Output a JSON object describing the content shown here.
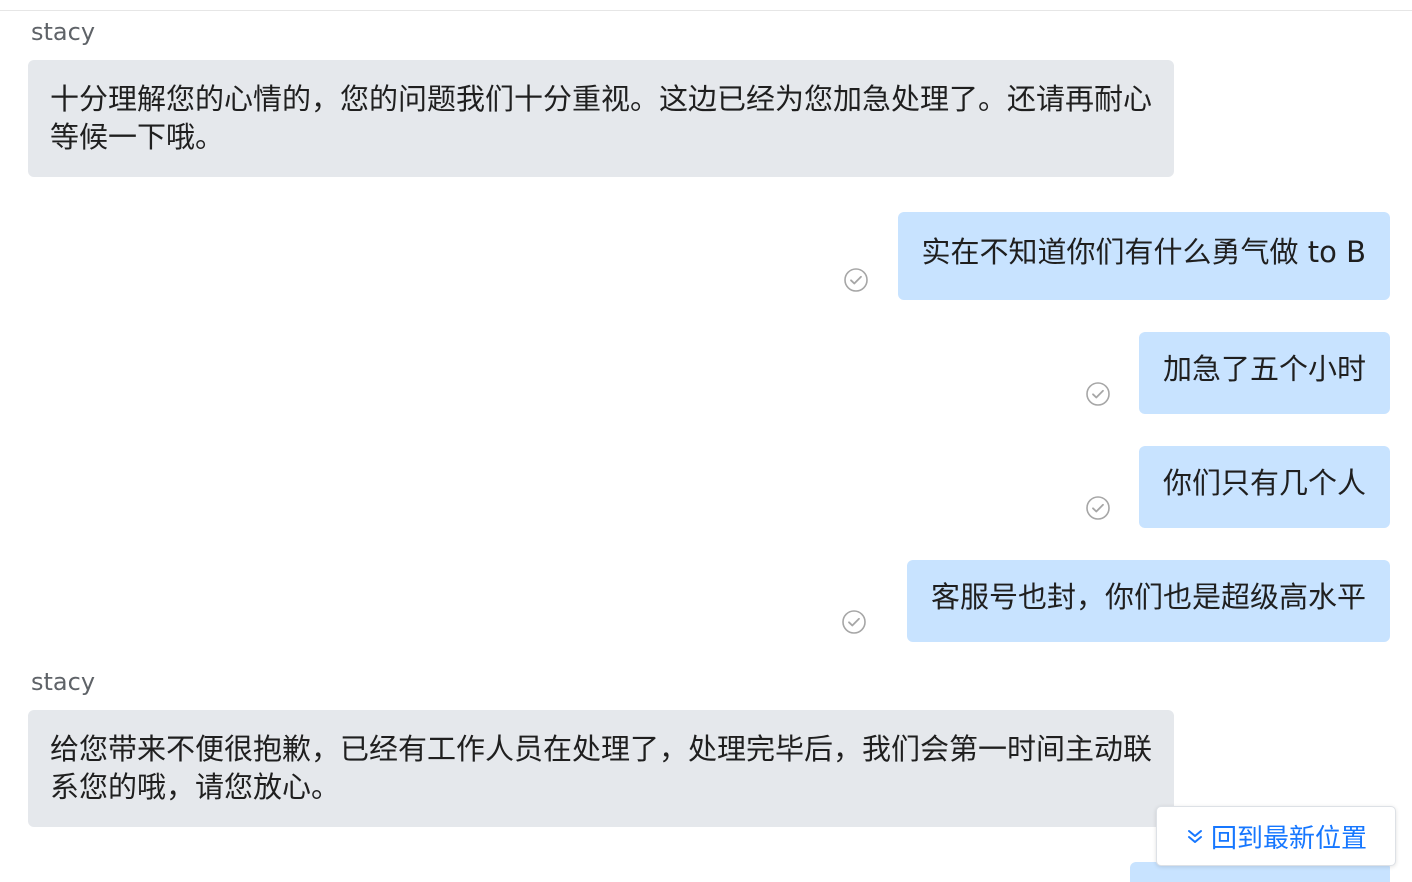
{
  "messages": [
    {
      "sender": "stacy",
      "text": "十分理解您的心情的，您的问题我们十分重视。这边已经为您加急处理了。还请再耐心等候一下哦。"
    },
    {
      "text": "实在不知道你们有什么勇气做 to B",
      "status_icon": "read-check-icon"
    },
    {
      "text": "加急了五个小时",
      "status_icon": "read-check-icon"
    },
    {
      "text": "你们只有几个人",
      "status_icon": "read-check-icon"
    },
    {
      "text": "客服号也封，你们也是超级高水平",
      "status_icon": "read-check-icon"
    },
    {
      "sender": "stacy",
      "text": "给您带来不便很抱歉，已经有工作人员在处理了，处理完毕后，我们会第一时间主动联系您的哦，请您放心。"
    }
  ],
  "scroll_button": {
    "label": "回到最新位置",
    "icon": "double-chevron-down-icon"
  },
  "colors": {
    "incoming_bubble": "#e5e8ec",
    "outgoing_bubble": "#c8e3ff",
    "accent": "#1677ff",
    "sender_name": "#5f6368",
    "check_icon": "#a6a6a6"
  }
}
